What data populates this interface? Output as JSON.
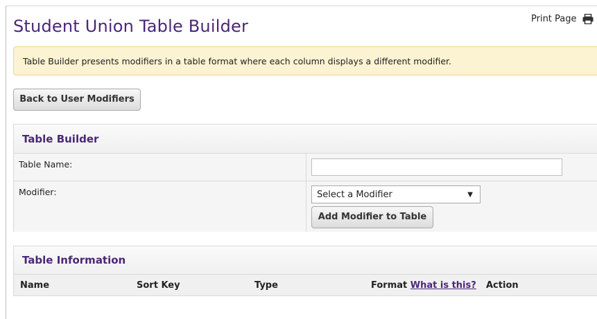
{
  "page": {
    "title": "Student Union Table Builder",
    "print_label": "Print Page",
    "print_icon": "printer-icon",
    "notice": "Table Builder presents modifiers in a table format where each column displays a different modifier."
  },
  "buttons": {
    "back": "Back to User Modifiers",
    "add_modifier": "Add Modifier to Table"
  },
  "builder": {
    "heading": "Table Builder",
    "table_name_label": "Table Name:",
    "table_name_value": "",
    "modifier_label": "Modifier:",
    "modifier_selected": "Select a Modifier"
  },
  "info": {
    "heading": "Table Information",
    "columns": [
      "Name",
      "Sort Key",
      "Type",
      "Format",
      "Action"
    ],
    "format_link": "What is this?"
  },
  "colors": {
    "accent": "#4b2778",
    "notice_bg": "#fcf3d2",
    "notice_border": "#f1d48a"
  }
}
